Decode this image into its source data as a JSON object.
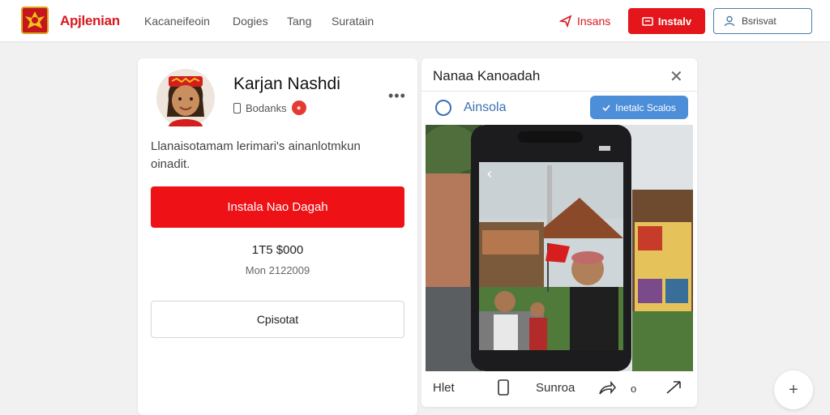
{
  "header": {
    "brand": "Apjlenian",
    "nav": [
      "Kacaneifeoin",
      "Dogies",
      "Tang",
      "Suratain"
    ],
    "action_link": "Insans",
    "action_button": "Instalv",
    "search_placeholder": "Bsrisvat"
  },
  "profile": {
    "name": "Karjan Nashdi",
    "status": "Bodanks",
    "more": "•••",
    "description": "Llanaisotamam lerimari's ainanlotmkun oinadit.",
    "primary_button": "Instala Nao Dagah",
    "price": "1T5 $000",
    "price_note": "Mon 2122009",
    "secondary_button": "Cpisotat"
  },
  "panel": {
    "title": "Nanaa Kanoadah",
    "option_label": "Ainsola",
    "pill_label": "Inetalc Scalos",
    "bottom": {
      "left": "Hlet",
      "middle": "Sunroa",
      "dot": "o"
    }
  },
  "fab": "+",
  "colors": {
    "brand_red": "#d9181f",
    "primary_red": "#ee1116",
    "link_blue": "#3c6fb5",
    "pill_blue": "#4d8ed9"
  }
}
